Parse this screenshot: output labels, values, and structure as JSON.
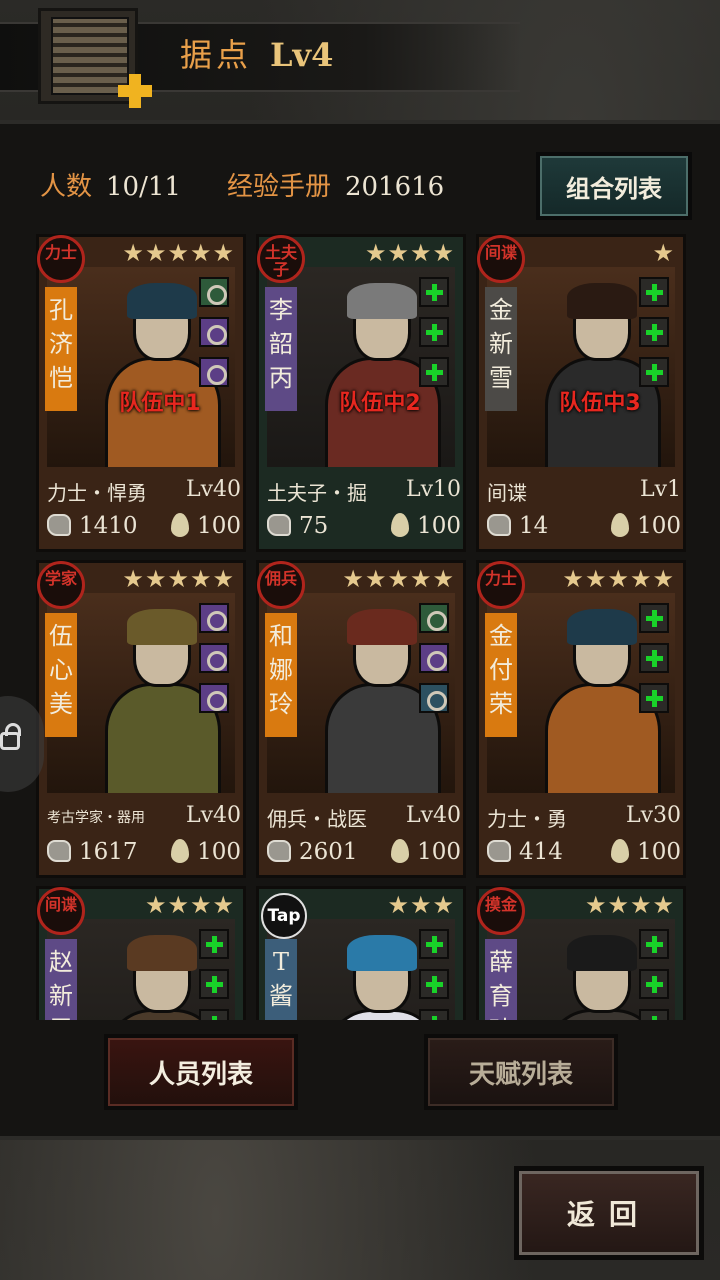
{
  "header": {
    "title": "据点",
    "level": "Lv4",
    "icons": {
      "base": "base-building-icon",
      "upgrade": "plus-icon"
    }
  },
  "stats": {
    "headcount_label": "人数",
    "headcount_value": "10/11",
    "exp_label": "经验手册",
    "exp_value": "201616"
  },
  "buttons": {
    "combo_list": "组合列表",
    "staff_list": "人员列表",
    "talent_list": "天赋列表",
    "back": "返回"
  },
  "colors": {
    "accent_orange": "#e39445",
    "team_red": "#e7271f",
    "plus_green": "#19d229",
    "gold_badge": "#f0b320"
  },
  "characters": [
    {
      "role": "力士",
      "name": "孔济恺",
      "stars": "★★★★★",
      "team": "队伍中1",
      "class": "力士・悍勇",
      "level": "Lv40",
      "power": "1410",
      "stamina": "100",
      "banner": "orange",
      "slots": [
        "eq g",
        "eq",
        "eq"
      ]
    },
    {
      "role": "土夫子",
      "name": "李韶丙",
      "stars": "★★★★",
      "team": "队伍中2",
      "class": "土夫子・掘",
      "level": "Lv10",
      "power": "75",
      "stamina": "100",
      "banner": "purple",
      "slots": [
        "add",
        "add",
        "add"
      ]
    },
    {
      "role": "间谍",
      "name": "金新雪",
      "stars": "★",
      "team": "队伍中3",
      "class": "间谍",
      "level": "Lv1",
      "power": "14",
      "stamina": "100",
      "banner": "gray",
      "slots": [
        "add",
        "add",
        "add"
      ]
    },
    {
      "role": "学家",
      "name": "伍心美",
      "stars": "★★★★★",
      "team": "",
      "class": "考古学家・器用",
      "level": "Lv40",
      "power": "1617",
      "stamina": "100",
      "banner": "orange",
      "slots": [
        "eq",
        "eq",
        "eq"
      ]
    },
    {
      "role": "佣兵",
      "name": "和娜玲",
      "stars": "★★★★★",
      "team": "",
      "class": "佣兵・战医",
      "level": "Lv40",
      "power": "2601",
      "stamina": "100",
      "banner": "orange",
      "slots": [
        "eq g",
        "eq",
        "eq b"
      ]
    },
    {
      "role": "力士",
      "name": "金付荣",
      "stars": "★★★★★",
      "team": "",
      "class": "力士・勇",
      "level": "Lv30",
      "power": "414",
      "stamina": "100",
      "banner": "orange",
      "slots": [
        "add",
        "add",
        "add"
      ]
    },
    {
      "role": "间谍",
      "name": "赵新雪",
      "stars": "★★★★",
      "team": "",
      "class": "",
      "level": "",
      "power": "",
      "stamina": "",
      "banner": "purple",
      "slots": [
        "add",
        "add",
        "add"
      ]
    },
    {
      "role": "Tap",
      "name": "T酱",
      "stars": "★★★",
      "team": "",
      "class": "",
      "level": "",
      "power": "",
      "stamina": "",
      "banner": "steel",
      "slots": [
        "add",
        "add",
        "add"
      ]
    },
    {
      "role": "摸金",
      "name": "薛育玮",
      "stars": "★★★★",
      "team": "",
      "class": "",
      "level": "",
      "power": "",
      "stamina": "",
      "banner": "purple",
      "slots": [
        "add",
        "add",
        "add"
      ]
    }
  ]
}
